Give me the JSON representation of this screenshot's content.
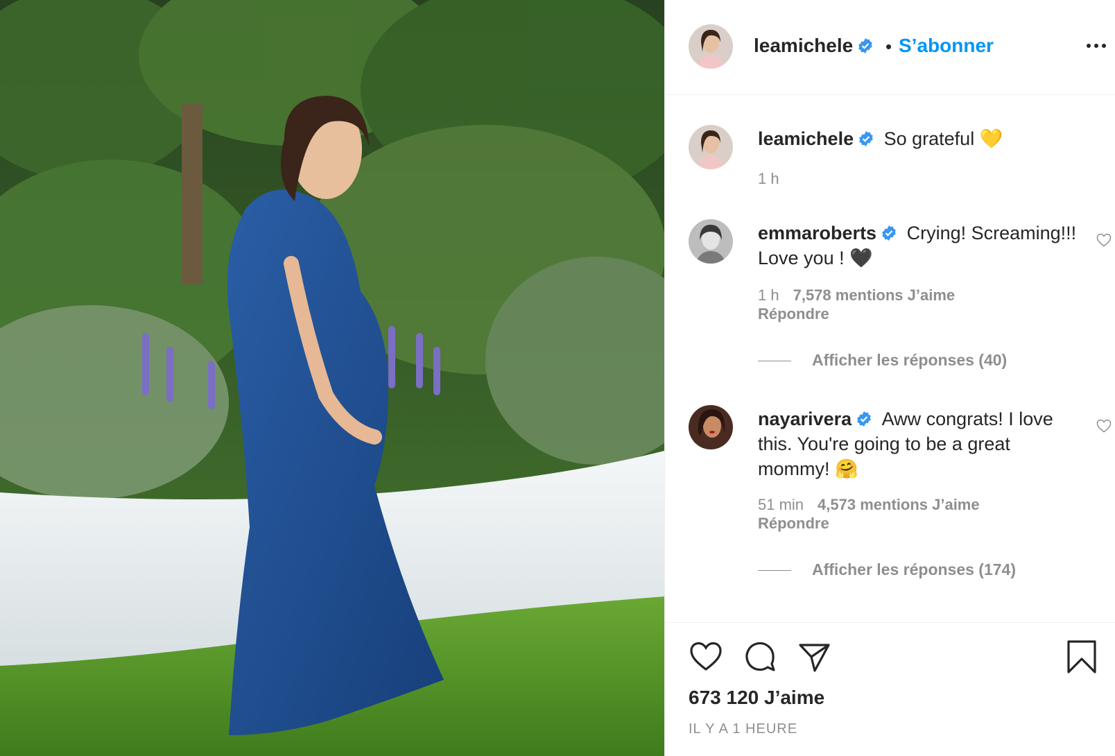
{
  "post": {
    "image_alt": "",
    "author": {
      "username": "leamichele",
      "verified": true,
      "follow_label": "S’abonner",
      "separator": "•"
    },
    "caption": {
      "username": "leamichele",
      "text": "So grateful 💛",
      "time": "1 h"
    },
    "comments": [
      {
        "username": "emmaroberts",
        "text": "Crying! Screaming!!! Love you ! 🖤",
        "time": "1 h",
        "likes": "7,578 mentions J’aime",
        "reply_label": "Répondre",
        "view_replies": "Afficher les réponses (40)"
      },
      {
        "username": "nayarivera",
        "text": "Aww congrats! I love this. You're going to be a great mommy! 🤗",
        "time": "51 min",
        "likes": "4,573 mentions J’aime",
        "reply_label": "Répondre",
        "view_replies": "Afficher les réponses (174)"
      }
    ],
    "likes_count": "673 120 J’aime",
    "posted_ago": "IL Y A 1 HEURE"
  },
  "icons": {
    "more": "more-options-icon",
    "like": "heart-icon",
    "comment": "comment-icon",
    "share": "share-icon",
    "save": "bookmark-icon",
    "verified": "verified-badge-icon"
  },
  "colors": {
    "accent": "#0095f6",
    "verified": "#3897f0",
    "text": "#262626",
    "muted": "#8e8e8e"
  }
}
